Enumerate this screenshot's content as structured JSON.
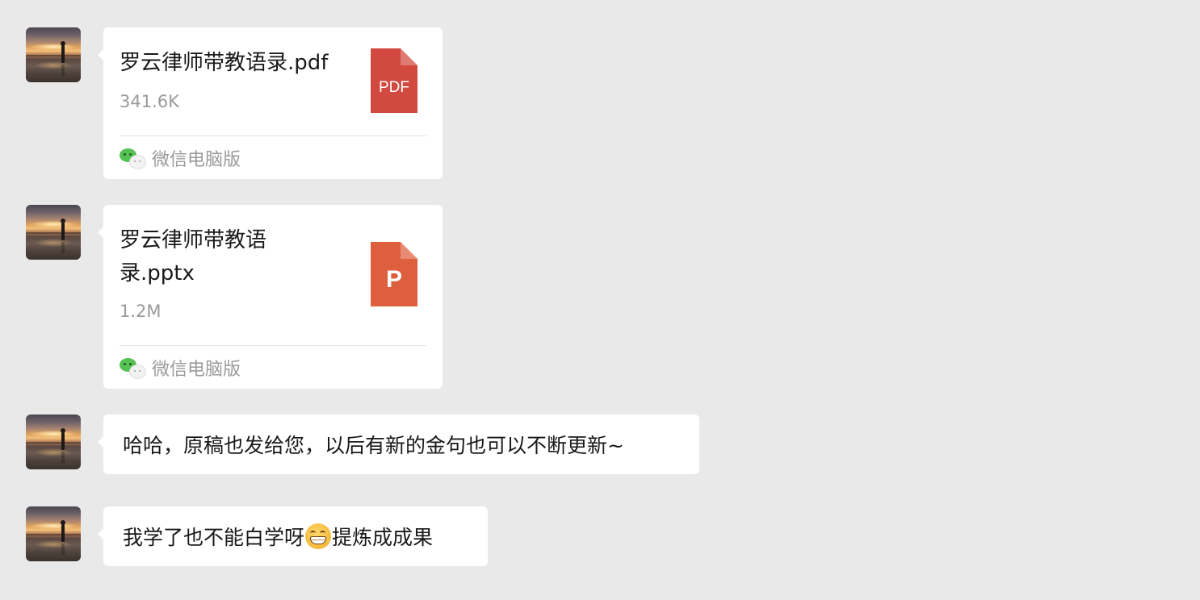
{
  "messages": [
    {
      "type": "file",
      "file_name": "罗云律师带教语录.pdf",
      "file_size": "341.6K",
      "icon_label": "PDF",
      "icon_color": "#d24a3f",
      "source": "微信电脑版"
    },
    {
      "type": "file",
      "file_name": "罗云律师带教语录.pptx",
      "file_size": "1.2M",
      "icon_label": "P",
      "icon_color": "#de5f3e",
      "source": "微信电脑版"
    },
    {
      "type": "text",
      "text": "哈哈，原稿也发给您，以后有新的金句也可以不断更新~"
    },
    {
      "type": "text",
      "text_before": "我学了也不能白学呀",
      "emoji": "grimacing-emoji",
      "text_after": "提炼成成果"
    }
  ],
  "colors": {
    "background": "#e9e9e9",
    "bubble": "#ffffff",
    "secondary_text": "#9a9a9a",
    "wechat_green": "#55c152"
  }
}
